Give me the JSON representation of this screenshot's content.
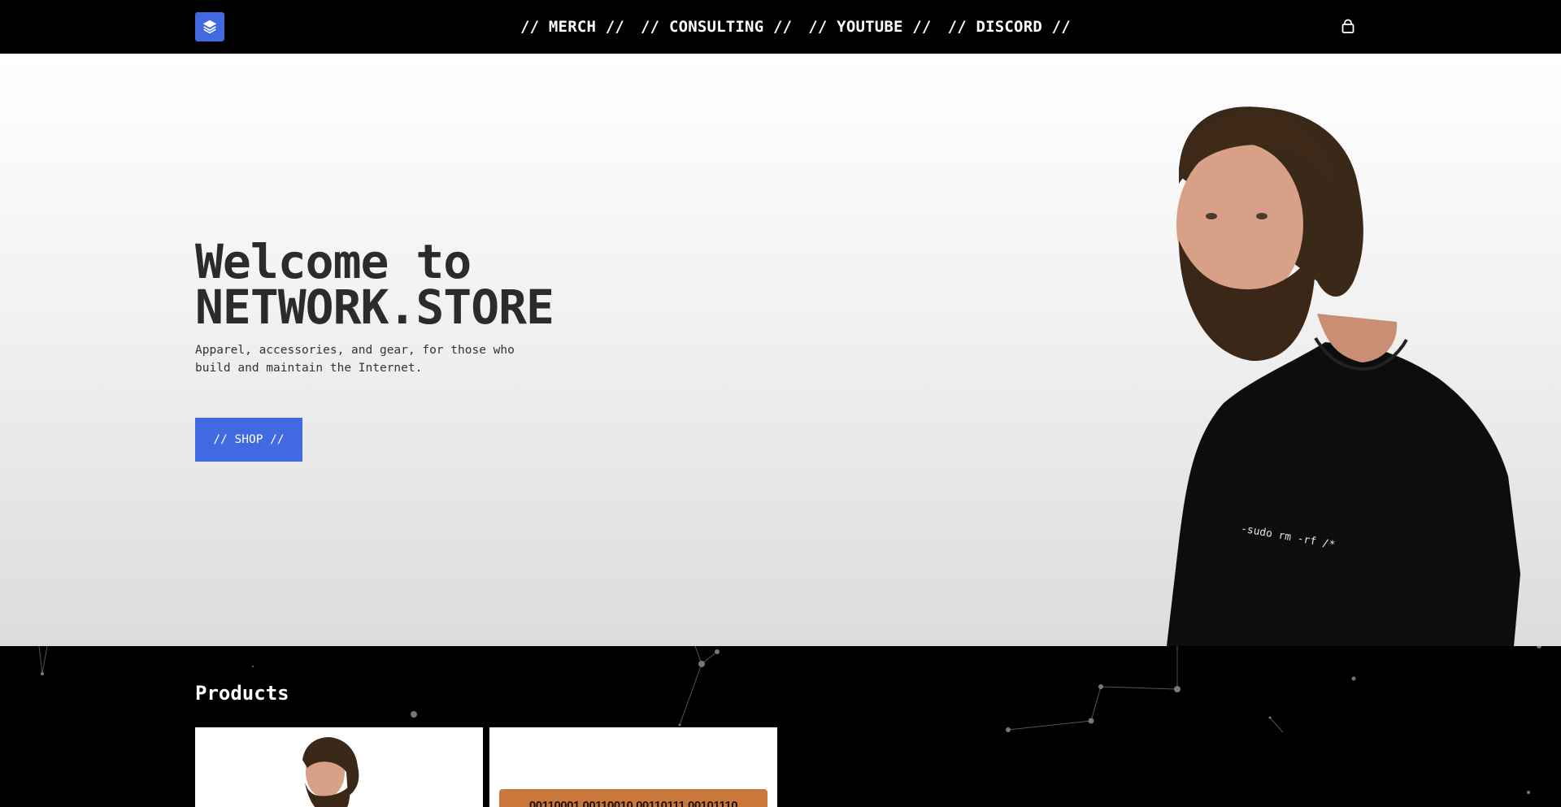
{
  "nav": {
    "links": [
      "// MERCH //",
      "// CONSULTING //",
      "// YOUTUBE //",
      "// DISCORD //"
    ],
    "logo_icon": "layers-icon",
    "cart_icon": "shopping-bag-icon",
    "accent": "#4169e1"
  },
  "hero": {
    "title_line1": "Welcome to",
    "title_line2": "NETWORK.STORE",
    "subtitle": "Apparel, accessories, and gear, for those who build and maintain the Internet.",
    "shop_label": "// SHOP //",
    "shirt_text": "-sudo rm -rf /*"
  },
  "products": {
    "title": "Products",
    "doormat_text": "00110001 00110010 00110111 00101110"
  }
}
